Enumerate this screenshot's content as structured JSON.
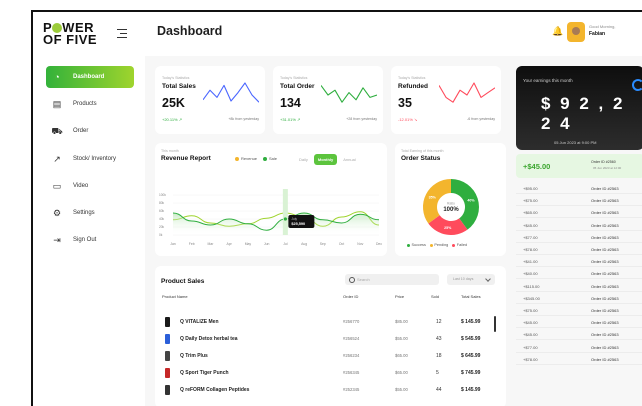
{
  "brand": {
    "line1_pre": "P",
    "line1_post": "WER",
    "line2": "OF FIVE"
  },
  "sidebar": {
    "items": [
      {
        "label": "Dashboard",
        "icon": "pie-chart-icon",
        "active": true
      },
      {
        "label": "Products",
        "icon": "clipboard-icon"
      },
      {
        "label": "Order",
        "icon": "cart-icon"
      },
      {
        "label": "Stock/ Inventory",
        "icon": "trend-icon"
      },
      {
        "label": "Video",
        "icon": "video-icon"
      },
      {
        "label": "Settings",
        "icon": "gear-icon"
      },
      {
        "label": "Sign Out",
        "icon": "logout-icon"
      }
    ]
  },
  "header": {
    "title": "Dashboard",
    "greeting": "Good Morning,",
    "user": "Fabian"
  },
  "stats": [
    {
      "small": "Today's Statistics",
      "label": "Total Sales",
      "value": "25K",
      "change": "+20.11% ↗",
      "foot": "+8k from yesterday",
      "color": "#4a66ff",
      "spark": [
        6,
        14,
        8,
        18,
        5,
        12,
        20,
        10,
        4
      ]
    },
    {
      "small": "Today's Statistics",
      "label": "Total Order",
      "value": "134",
      "change": "+31.01% ↗",
      "foot": "+28 from yesterday",
      "color": "#2fae3f",
      "spark": [
        18,
        10,
        14,
        4,
        12,
        6,
        16,
        8,
        10
      ]
    },
    {
      "small": "Today's Statistics",
      "label": "Refunded",
      "value": "35",
      "change": "-12.01% ↘",
      "foot": "-6 from yesterday",
      "color": "#ff4b5c",
      "spark": [
        18,
        8,
        4,
        14,
        10,
        20,
        8,
        12,
        16
      ]
    }
  ],
  "revenue": {
    "small": "This month",
    "title": "Revenue Report",
    "legend": [
      {
        "label": "Revenue",
        "color": "#f3b52d"
      },
      {
        "label": "Sale",
        "color": "#2fae3f"
      }
    ],
    "tabs": [
      {
        "label": "Daily"
      },
      {
        "label": "Monthly",
        "on": true
      },
      {
        "label": "Annual"
      }
    ],
    "tooltip": {
      "month": "July",
      "value": "$25,590"
    }
  },
  "chart_data": {
    "type": "line",
    "categories": [
      "Jan",
      "Feb",
      "Mar",
      "Apr",
      "May",
      "Jun",
      "Jul",
      "Aug",
      "Sep",
      "Oct",
      "Nov",
      "Dec"
    ],
    "ylim": [
      0,
      100
    ],
    "yticks": [
      "100k",
      "80k",
      "60k",
      "40k",
      "20k",
      "0k"
    ],
    "series": [
      {
        "name": "Revenue",
        "values": [
          38,
          48,
          30,
          22,
          28,
          42,
          55,
          45,
          22,
          45,
          58,
          25
        ]
      },
      {
        "name": "Sale",
        "values": [
          55,
          35,
          25,
          40,
          28,
          12,
          40,
          55,
          38,
          30,
          52,
          38
        ]
      }
    ]
  },
  "order_status": {
    "small": "Total Earning of this month",
    "title": "Order Status",
    "center_label": "Ratio",
    "center_value": "100%",
    "segments": [
      {
        "label": "Success",
        "value": 40,
        "color": "#2fae3f",
        "text": "40%"
      },
      {
        "label": "Failed",
        "value": 25,
        "color": "#ff4b5c",
        "text": "25%"
      },
      {
        "label": "Pending",
        "value": 35,
        "color": "#f3b52d",
        "text": "35%"
      }
    ]
  },
  "product_sales": {
    "title": "Product Sales",
    "search_placeholder": "Search",
    "filter": "Last 10 days",
    "columns": [
      "Product Name",
      "Order ID",
      "Price",
      "Sold",
      "Total Sales"
    ],
    "rows": [
      {
        "name": "Q VITALIZE Men",
        "id": "#256770",
        "price": "$85.00",
        "sold": "12",
        "total": "$ 145.99",
        "color": "#1a1a1a"
      },
      {
        "name": "Q Daily Detox herbal tea",
        "id": "#256524",
        "price": "$55.00",
        "sold": "43",
        "total": "$ 545.99",
        "color": "#2b5fd9"
      },
      {
        "name": "Q Trim Plus",
        "id": "#256234",
        "price": "$65.00",
        "sold": "18",
        "total": "$ 645.99",
        "color": "#444444"
      },
      {
        "name": "Q Sport Tiger Punch",
        "id": "#256345",
        "price": "$65.00",
        "sold": "5",
        "total": "$ 745.99",
        "color": "#c62828"
      },
      {
        "name": "Q reFORM Collagen Peptides",
        "id": "#252345",
        "price": "$55.00",
        "sold": "44",
        "total": "$ 145.99",
        "color": "#333333"
      }
    ]
  },
  "earnings": {
    "label": "Your earnings this month",
    "amount": "$ 9 2 , 2 2 4",
    "date": "05 Jun 2023 at 9:00 PM"
  },
  "transactions": {
    "first": {
      "amount": "+$45.00",
      "order": "Order ID   #2560",
      "date": "05 Jun 2023 at 12:00"
    },
    "list": [
      {
        "amount": "+$95.00",
        "order": "Order ID   #2563"
      },
      {
        "amount": "+$75.00",
        "order": "Order ID   #2563"
      },
      {
        "amount": "+$65.00",
        "order": "Order ID   #2563"
      },
      {
        "amount": "+$45.00",
        "order": "Order ID   #2563"
      },
      {
        "amount": "+$77.00",
        "order": "Order ID   #2563"
      },
      {
        "amount": "+$78.00",
        "order": "Order ID   #2563"
      },
      {
        "amount": "+$41.00",
        "order": "Order ID   #2563"
      },
      {
        "amount": "+$40.00",
        "order": "Order ID   #2563"
      },
      {
        "amount": "+$115.00",
        "order": "Order ID   #2563"
      },
      {
        "amount": "+$345.00",
        "order": "Order ID   #2563"
      },
      {
        "amount": "+$75.00",
        "order": "Order ID   #2563"
      },
      {
        "amount": "+$45.00",
        "order": "Order ID   #2563"
      },
      {
        "amount": "+$45.00",
        "order": "Order ID   #2563"
      },
      {
        "amount": "+$77.00",
        "order": "Order ID   #2563"
      },
      {
        "amount": "+$78.00",
        "order": "Order ID   #2563"
      }
    ]
  }
}
